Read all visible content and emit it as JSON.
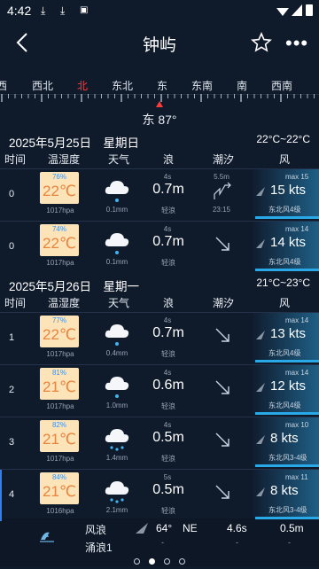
{
  "status_bar": {
    "time": "4:42"
  },
  "header": {
    "title": "钟屿"
  },
  "compass": {
    "labels": [
      "西",
      "西北",
      "北",
      "东北",
      "东",
      "东南",
      "南",
      "西南"
    ],
    "readout": "东 87°"
  },
  "days": [
    {
      "date": "2025年5月25日　星期日",
      "temp_range": "22°C~22°C",
      "columns": [
        "时间",
        "温湿度",
        "天气",
        "浪",
        "潮汐",
        "风"
      ],
      "rows": [
        {
          "hour": "0",
          "humidity": "76%",
          "temp": "22℃",
          "pressure": "1017hpa",
          "rain": "0.1mm",
          "wave_period": "4s",
          "wave_height": "0.7m",
          "wave_desc": "轻浪",
          "tide_top": "5.5m",
          "tide_bottom": "23:15",
          "tide_type": "rise",
          "wind_max": "max 15",
          "wind_kts": "15 kts",
          "wind_dir": "东北风4级"
        },
        {
          "hour": "0",
          "humidity": "74%",
          "temp": "22℃",
          "pressure": "1017hpa",
          "rain": "0.1mm",
          "wave_period": "4s",
          "wave_height": "0.7m",
          "wave_desc": "轻浪",
          "tide_top": "",
          "tide_bottom": "",
          "tide_type": "fall",
          "wind_max": "max 14",
          "wind_kts": "14 kts",
          "wind_dir": "东北风4级"
        }
      ]
    },
    {
      "date": "2025年5月26日　星期一",
      "temp_range": "21°C~23°C",
      "columns": [
        "时间",
        "温湿度",
        "天气",
        "浪",
        "潮汐",
        "风"
      ],
      "rows": [
        {
          "hour": "1",
          "humidity": "77%",
          "temp": "22℃",
          "pressure": "1017hpa",
          "rain": "0.4mm",
          "wave_period": "4s",
          "wave_height": "0.7m",
          "wave_desc": "轻浪",
          "tide_top": "",
          "tide_bottom": "",
          "tide_type": "fall",
          "wind_max": "max 14",
          "wind_kts": "13 kts",
          "wind_dir": "东北风4级"
        },
        {
          "hour": "2",
          "humidity": "81%",
          "temp": "21℃",
          "pressure": "1017hpa",
          "rain": "1.0mm",
          "wave_period": "4s",
          "wave_height": "0.6m",
          "wave_desc": "轻浪",
          "tide_top": "",
          "tide_bottom": "",
          "tide_type": "fall",
          "wind_max": "max 14",
          "wind_kts": "12 kts",
          "wind_dir": "东北风4级"
        },
        {
          "hour": "3",
          "humidity": "82%",
          "temp": "21℃",
          "pressure": "1017hpa",
          "rain": "1.4mm",
          "wave_period": "4s",
          "wave_height": "0.5m",
          "wave_desc": "轻浪",
          "tide_top": "",
          "tide_bottom": "",
          "tide_type": "fall",
          "wind_max": "max 10",
          "wind_kts": "8 kts",
          "wind_dir": "东北风3-4级"
        },
        {
          "hour": "4",
          "humidity": "84%",
          "temp": "21℃",
          "pressure": "1016hpa",
          "rain": "2.1mm",
          "wave_period": "5s",
          "wave_height": "0.5m",
          "wave_desc": "轻浪",
          "tide_top": "",
          "tide_bottom": "",
          "tide_type": "fall",
          "wind_max": "max 11",
          "wind_kts": "8 kts",
          "wind_dir": "东北风3-4级"
        }
      ]
    }
  ],
  "footer": {
    "label1": "风浪",
    "label2": "涌浪1",
    "deg": "64°",
    "dir": "NE",
    "period": "4.6s",
    "height": "0.5m",
    "dash": "-"
  },
  "page_dots": {
    "count": 4,
    "active": 1
  }
}
